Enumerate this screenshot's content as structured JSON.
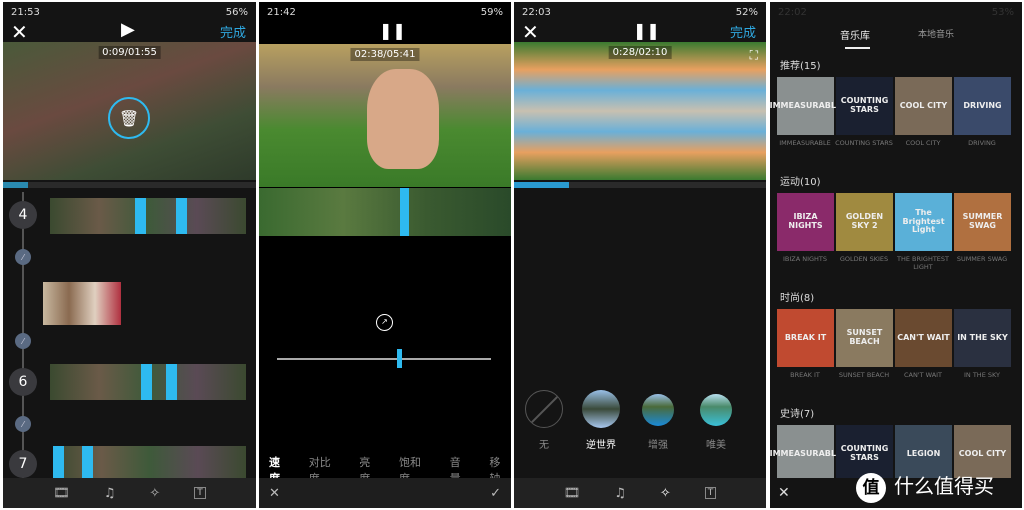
{
  "panel1": {
    "time": "21:53",
    "battery": "56%",
    "close_icon": "close-icon",
    "play_icon": "play-icon",
    "done": "完成",
    "timecode": "0:09/01:55",
    "clips": [
      {
        "number": "4"
      },
      {
        "number": "6"
      },
      {
        "number": "7"
      }
    ],
    "toolbar": [
      "film-icon",
      "music-icon",
      "magic-wand-icon",
      "text-icon"
    ]
  },
  "panel2": {
    "time": "21:42",
    "battery": "59%",
    "timecode": "02:38/05:41",
    "speed_icon": "speedometer-icon",
    "slider_value": 0.57,
    "tabs": [
      "速度",
      "对比度",
      "亮度",
      "饱和度",
      "音量",
      "移轴"
    ],
    "active_tab": "速度"
  },
  "panel3": {
    "time": "22:03",
    "battery": "52%",
    "done": "完成",
    "timecode": "0:28/02:10",
    "filters": [
      "无",
      "逆世界",
      "增强",
      "唯美"
    ],
    "selected_filter": "逆世界",
    "progress": 0.22
  },
  "panel4": {
    "time": "22:02",
    "battery": "53%",
    "tabs": [
      "音乐库",
      "本地音乐"
    ],
    "active_tab": "音乐库",
    "sections": [
      {
        "title": "推荐(15)",
        "items": [
          {
            "art": "IMMEASURABLE",
            "label": "IMMEASURABLE"
          },
          {
            "art": "COUNTING STARS",
            "label": "COUNTING STARS"
          },
          {
            "art": "COOL CITY",
            "label": "COOL CITY"
          },
          {
            "art": "DRIVING",
            "label": "DRIVING"
          }
        ]
      },
      {
        "title": "运动(10)",
        "items": [
          {
            "art": "IBIZA NIGHTS",
            "label": "IBIZA NIGHTS"
          },
          {
            "art": "GOLDEN SKY 2",
            "label": "GOLDEN SKIES"
          },
          {
            "art": "The Brightest Light",
            "label": "THE BRIGHTEST LIGHT"
          },
          {
            "art": "SUMMER SWAG",
            "label": "SUMMER SWAG"
          }
        ]
      },
      {
        "title": "时尚(8)",
        "items": [
          {
            "art": "BREAK IT",
            "label": "BREAK IT"
          },
          {
            "art": "SUNSET BEACH",
            "label": "SUNSET BEACH"
          },
          {
            "art": "CAN'T WAIT",
            "label": "CAN'T WAIT"
          },
          {
            "art": "IN THE SKY",
            "label": "IN THE SKY"
          }
        ]
      },
      {
        "title": "史诗(7)",
        "items": [
          {
            "art": "IMMEASURABLE"
          },
          {
            "art": "COUNTING STARS"
          },
          {
            "art": "LEGION"
          },
          {
            "art": "COOL CITY"
          }
        ]
      }
    ]
  },
  "watermark": "值 什么值得买"
}
